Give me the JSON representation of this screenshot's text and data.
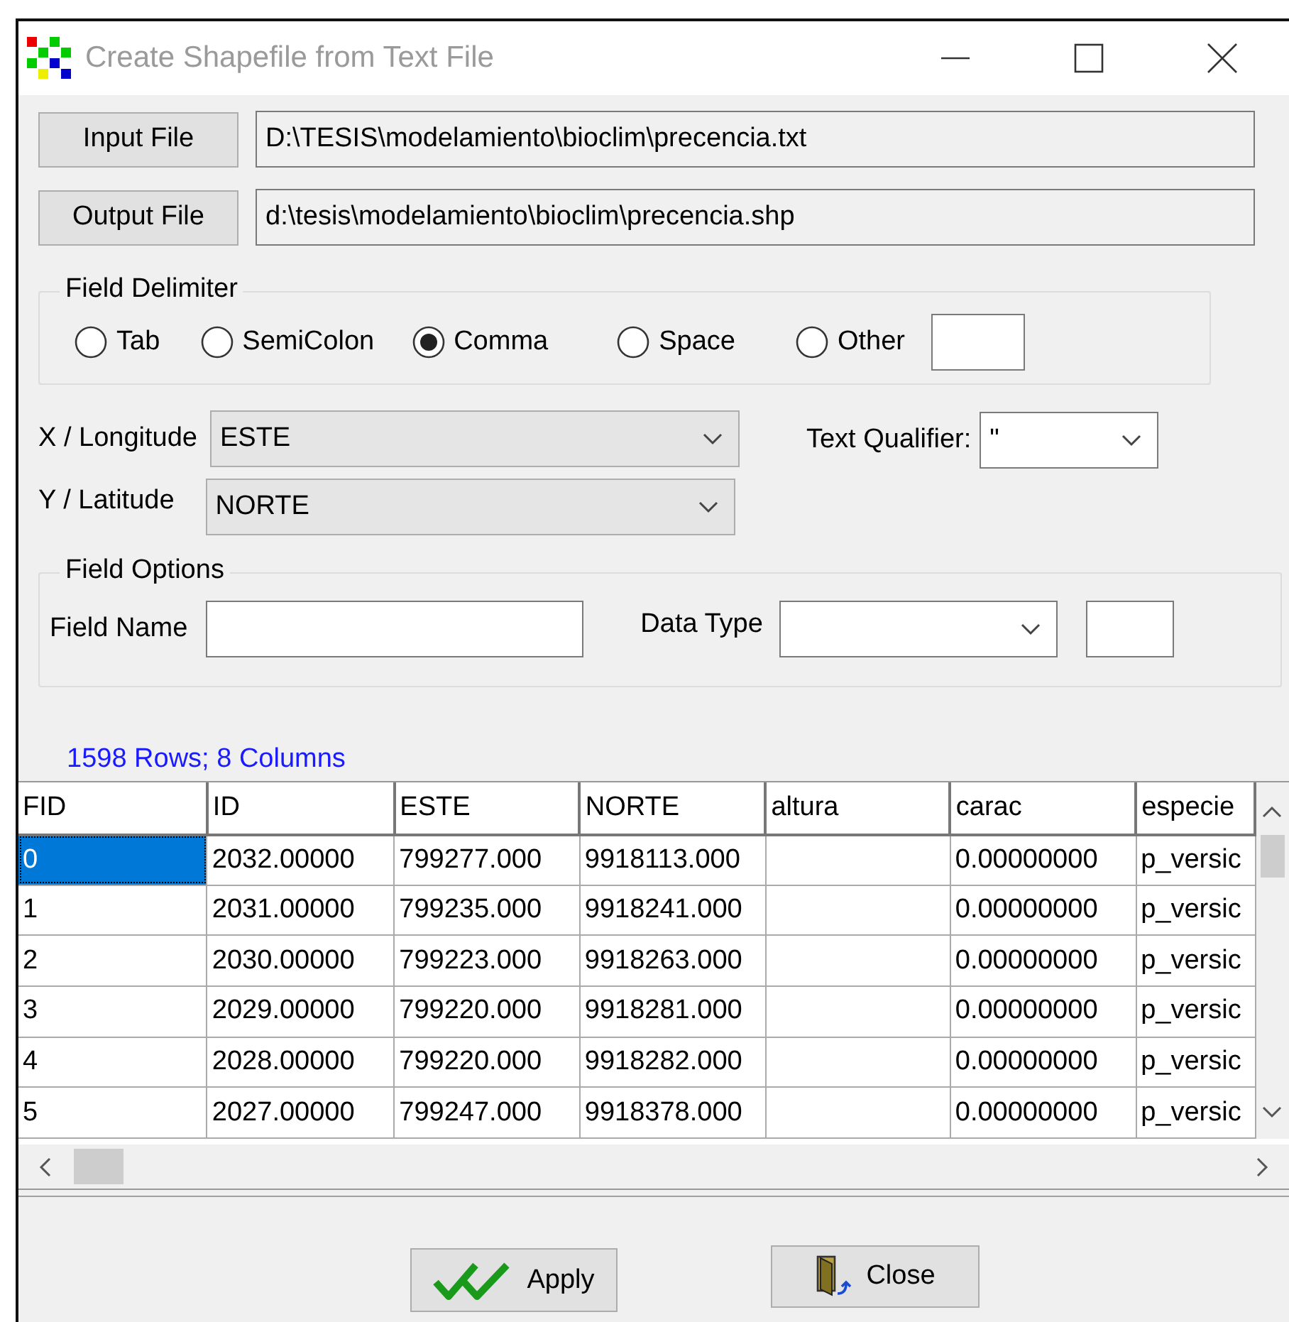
{
  "window": {
    "title": "Create Shapefile from Text File"
  },
  "files": [
    {
      "button": "Input File",
      "path": "D:\\TESIS\\modelamiento\\bioclim\\precencia.txt"
    },
    {
      "button": "Output File",
      "path": "d:\\tesis\\modelamiento\\bioclim\\precencia.shp"
    }
  ],
  "field_delimiter": {
    "label": "Field Delimiter",
    "options": [
      {
        "label": "Tab",
        "selected": false,
        "kind": "plain"
      },
      {
        "label": "SemiColon",
        "selected": false,
        "kind": "plain"
      },
      {
        "label": "Comma",
        "selected": true,
        "kind": "plain"
      },
      {
        "label": "Space",
        "selected": false,
        "kind": "plain"
      },
      {
        "label": "Other",
        "selected": false,
        "kind": "other"
      }
    ]
  },
  "coordinates": [
    {
      "label": "X / Longitude",
      "value": "ESTE"
    },
    {
      "label": "Y / Latitude",
      "value": "NORTE"
    }
  ],
  "text_qualifier": {
    "label": "Text Qualifier:",
    "value": "\""
  },
  "field_options": {
    "label": "Field Options",
    "field_name_label": "Field Name",
    "data_type_label": "Data Type"
  },
  "summary": "1598 Rows; 8 Columns",
  "table": {
    "columns": [
      "FID",
      "ID",
      "ESTE",
      "NORTE",
      "altura",
      "carac",
      "especie"
    ],
    "rows": [
      {
        "selected": true,
        "cells": [
          "0",
          "2032.00000",
          "799277.000",
          "9918113.000",
          "",
          "0.00000000",
          "p_versic"
        ]
      },
      {
        "selected": false,
        "cells": [
          "1",
          "2031.00000",
          "799235.000",
          "9918241.000",
          "",
          "0.00000000",
          "p_versic"
        ]
      },
      {
        "selected": false,
        "cells": [
          "2",
          "2030.00000",
          "799223.000",
          "9918263.000",
          "",
          "0.00000000",
          "p_versic"
        ]
      },
      {
        "selected": false,
        "cells": [
          "3",
          "2029.00000",
          "799220.000",
          "9918281.000",
          "",
          "0.00000000",
          "p_versic"
        ]
      },
      {
        "selected": false,
        "cells": [
          "4",
          "2028.00000",
          "799220.000",
          "9918282.000",
          "",
          "0.00000000",
          "p_versic"
        ]
      },
      {
        "selected": false,
        "cells": [
          "5",
          "2027.00000",
          "799247.000",
          "9918378.000",
          "",
          "0.00000000",
          "p_versic"
        ]
      }
    ]
  },
  "buttons": [
    {
      "label": "Apply",
      "kind": "apply"
    },
    {
      "label": "Close",
      "kind": "close"
    }
  ]
}
